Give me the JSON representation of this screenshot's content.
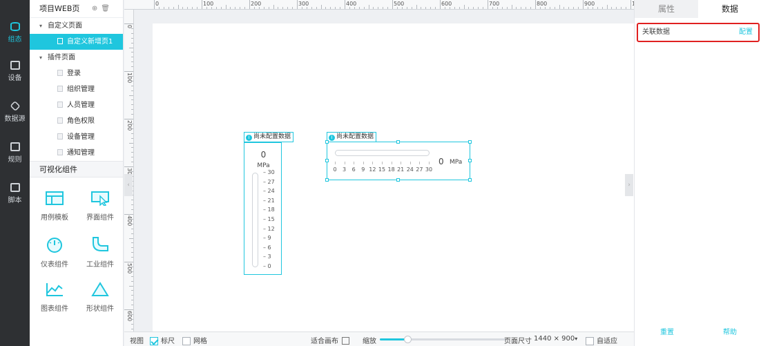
{
  "rail": {
    "items": [
      {
        "label": "组态",
        "icon": "database-icon",
        "active": true
      },
      {
        "label": "设备",
        "icon": "device-icon"
      },
      {
        "label": "数据源",
        "icon": "cube-icon"
      },
      {
        "label": "规则",
        "icon": "rule-icon"
      },
      {
        "label": "脚本",
        "icon": "script-icon"
      }
    ]
  },
  "tree": {
    "title": "项目WEB页",
    "groups": [
      {
        "label": "自定义页面",
        "children": [
          "自定义新增页1"
        ]
      },
      {
        "label": "插件页面",
        "children": [
          "登录",
          "组织管理",
          "人员管理",
          "角色权限",
          "设备管理",
          "通知管理"
        ]
      }
    ],
    "components_title": "可视化组件",
    "components": [
      "用例模板",
      "界面组件",
      "仪表组件",
      "工业组件",
      "图表组件",
      "形状组件"
    ]
  },
  "rulers": {
    "top": [
      "0",
      "100",
      "200",
      "300",
      "400",
      "500",
      "600",
      "700",
      "800",
      "900",
      "10"
    ],
    "left": [
      "0",
      "100",
      "200",
      "300",
      "400",
      "500",
      "600"
    ]
  },
  "widgets": {
    "badge_text": "尚未配置数据",
    "vertical": {
      "value": "0",
      "unit": "MPa",
      "ticks": [
        "30",
        "27",
        "24",
        "21",
        "18",
        "15",
        "12",
        "9",
        "6",
        "3",
        "0"
      ]
    },
    "horizontal": {
      "value": "0",
      "unit": "MPa",
      "ticks": [
        "0",
        "3",
        "6",
        "9",
        "12",
        "15",
        "18",
        "21",
        "24",
        "27",
        "30"
      ]
    }
  },
  "bottombar": {
    "view": "视图",
    "ruler": "标尺",
    "ruler_checked": true,
    "grid": "网格",
    "grid_checked": false,
    "fit": "适合画布",
    "zoom": "缩放",
    "zoom_level": 0.22,
    "page_size_label": "页面尺寸",
    "page_size": "1440 × 900",
    "adaptive": "自适应",
    "adaptive_checked": false
  },
  "rightpanel": {
    "tab_props": "属性",
    "tab_data": "数据",
    "assoc_label": "关联数据",
    "config": "配置",
    "reset": "重置",
    "help": "帮助"
  },
  "colors": {
    "accent": "#1fc6de",
    "highlight": "#e02020",
    "rail": "#2e3033"
  }
}
